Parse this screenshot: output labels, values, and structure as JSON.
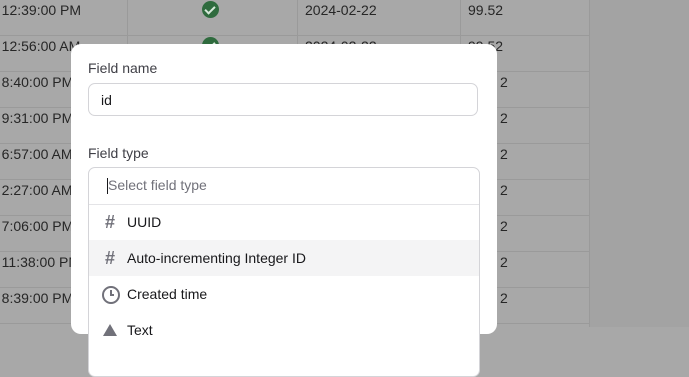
{
  "table": {
    "rows": [
      {
        "time": "3 12:39:00 PM",
        "checked": true,
        "date": "2024-02-22",
        "value": "99.52"
      },
      {
        "time": "3 12:56:00 AM",
        "checked": true,
        "date": "2024-02-22",
        "value": "99.52"
      },
      {
        "time": "3 8:40:00 PM",
        "checked": false,
        "date": "",
        "value": "2"
      },
      {
        "time": "3 9:31:00 PM",
        "checked": false,
        "date": "",
        "value": "2"
      },
      {
        "time": "3 6:57:00 AM",
        "checked": false,
        "date": "",
        "value": "2"
      },
      {
        "time": "3 2:27:00 AM",
        "checked": false,
        "date": "",
        "value": "2"
      },
      {
        "time": "3 7:06:00 PM",
        "checked": false,
        "date": "",
        "value": "2"
      },
      {
        "time": "3 11:38:00 PM",
        "checked": false,
        "date": "",
        "value": "2"
      },
      {
        "time": "3 8:39:00 PM",
        "checked": false,
        "date": "",
        "value": "2"
      }
    ]
  },
  "dialog": {
    "field_name_label": "Field name",
    "field_name_value": "id",
    "field_type_label": "Field type",
    "field_type_placeholder": "Select field type",
    "options": [
      {
        "label": "UUID",
        "icon": "hash-icon"
      },
      {
        "label": "Auto-incrementing Integer ID",
        "icon": "hash-icon"
      },
      {
        "label": "Created time",
        "icon": "clock-icon"
      },
      {
        "label": "Text",
        "icon": "text-icon"
      }
    ]
  }
}
